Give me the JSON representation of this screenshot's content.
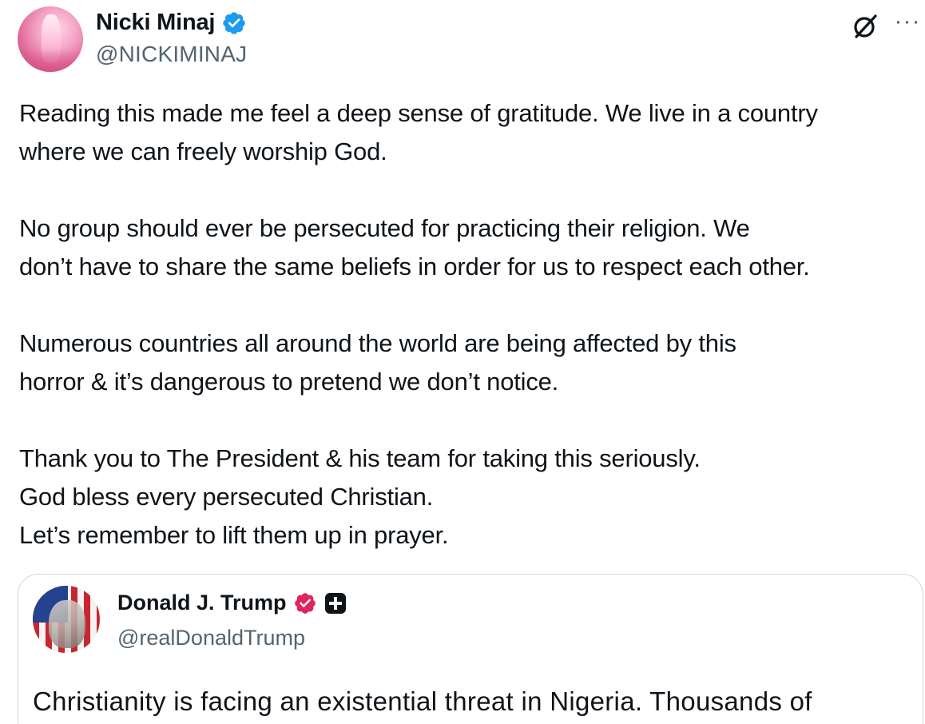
{
  "author": {
    "display_name": "Nicki Minaj",
    "handle": "@NICKIMINAJ",
    "verified_color": "#1d9bf0"
  },
  "actions": {
    "grok_icon": "grok-slash-circle-icon",
    "more_icon": "more-horizontal-icon",
    "more_label": "···"
  },
  "tweet": {
    "paragraphs": [
      [
        "Reading this made me feel a deep sense of gratitude. We live in a country",
        "where we can freely worship God."
      ],
      [
        "No group should ever be persecuted for practicing their religion. We",
        "don’t have to share the same beliefs in order for us to respect each other."
      ],
      [
        "Numerous countries all around the world are being affected by this",
        "horror & it’s dangerous to pretend we don’t notice."
      ],
      [
        "Thank you to The President & his team for taking this seriously.",
        "God bless every persecuted Christian.",
        "Let’s remember to lift them up in prayer."
      ]
    ]
  },
  "quoted": {
    "display_name": "Donald J. Trump",
    "handle": "@realDonaldTrump",
    "badge_color": "#e0245e",
    "text_preview": "Christianity is facing an existential threat in Nigeria. Thousands of"
  },
  "colors": {
    "text_primary": "#0f1419",
    "text_secondary": "#536471",
    "border": "#cfd9de"
  }
}
